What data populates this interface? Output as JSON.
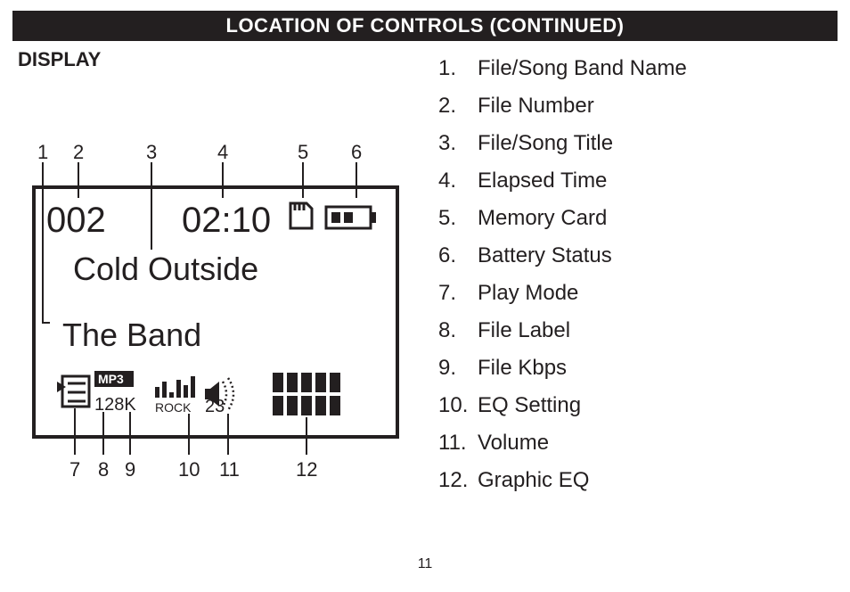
{
  "header": {
    "title": "LOCATION OF CONTROLS (CONTINUED)"
  },
  "section_label": "DISPLAY",
  "page_number": "11",
  "lcd": {
    "file_number": "002",
    "elapsed_time": "02:10",
    "song_title": "Cold Outside",
    "band_name": "The Band",
    "file_label": "MP3",
    "kbps": "128K",
    "eq_setting": "ROCK",
    "volume": "23"
  },
  "callouts_top": [
    "1",
    "2",
    "3",
    "4",
    "5",
    "6"
  ],
  "callouts_bottom": [
    "7",
    "8",
    "9",
    "10",
    "11",
    "12"
  ],
  "legend": {
    "items": [
      {
        "n": "1.",
        "t": "File/Song Band Name"
      },
      {
        "n": "2.",
        "t": "File Number"
      },
      {
        "n": "3.",
        "t": "File/Song Title"
      },
      {
        "n": "4.",
        "t": "Elapsed Time"
      },
      {
        "n": "5.",
        "t": "Memory Card"
      },
      {
        "n": "6.",
        "t": "Battery Status"
      },
      {
        "n": "7.",
        "t": "Play Mode"
      },
      {
        "n": "8.",
        "t": "File Label"
      },
      {
        "n": "9.",
        "t": "File Kbps"
      },
      {
        "n": "10.",
        "t": "EQ Setting"
      },
      {
        "n": "11.",
        "t": "Volume"
      },
      {
        "n": "12.",
        "t": "Graphic EQ"
      }
    ]
  }
}
